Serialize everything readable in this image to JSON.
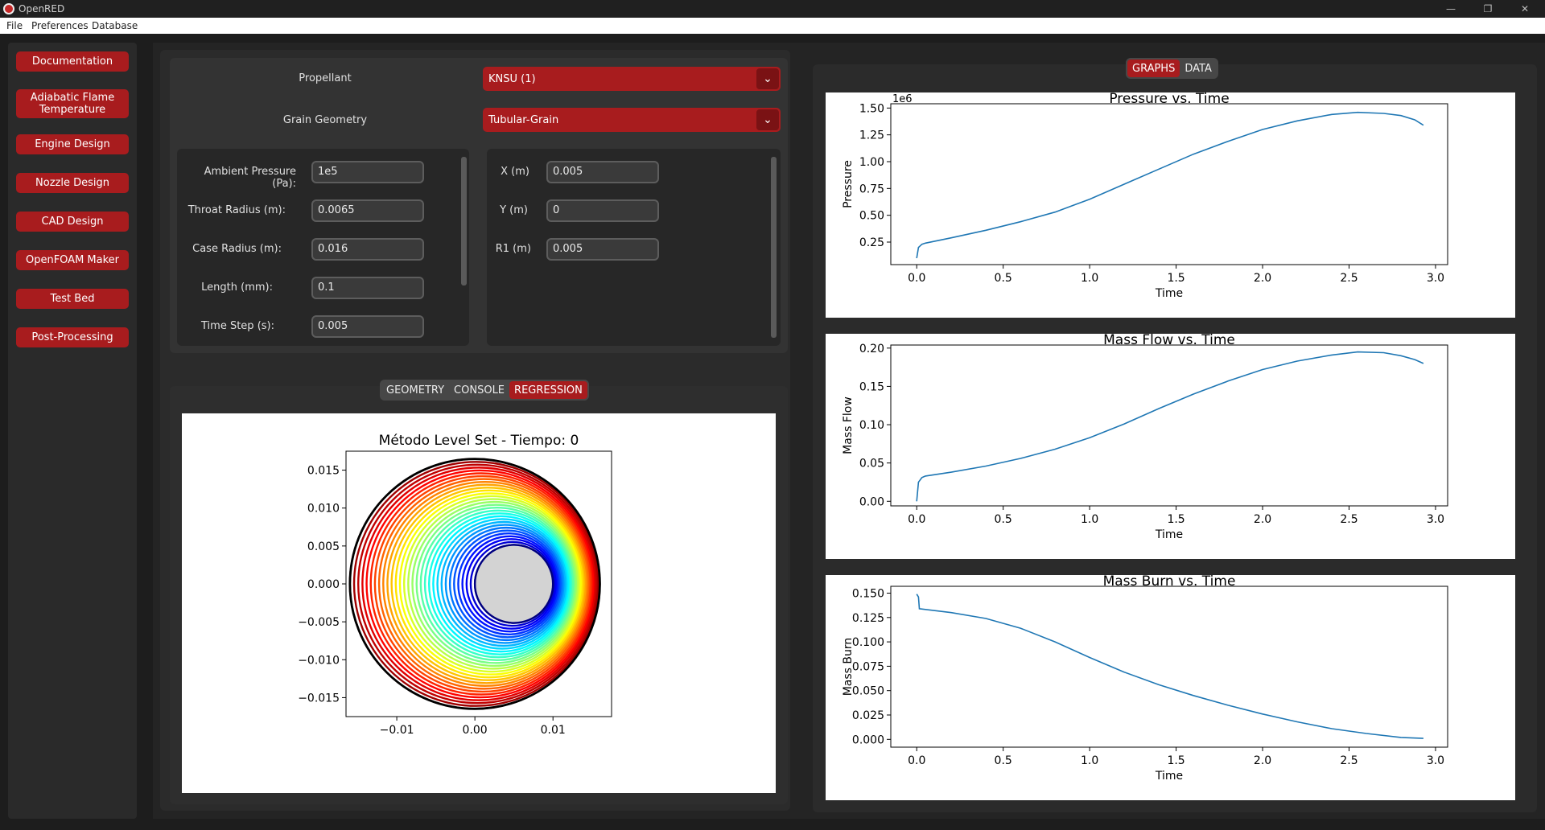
{
  "window": {
    "title": "OpenRED",
    "minimize_glyph": "—",
    "maximize_glyph": "❐",
    "close_glyph": "✕"
  },
  "menu": [
    "File",
    "Preferences",
    "Database"
  ],
  "sidebar": {
    "items": [
      {
        "label": "Documentation"
      },
      {
        "label": "Adiabatic Flame Temperature"
      },
      {
        "label": "Engine Design"
      },
      {
        "label": "Nozzle Design"
      },
      {
        "label": "CAD Design"
      },
      {
        "label": "OpenFOAM Maker"
      },
      {
        "label": "Test Bed"
      },
      {
        "label": "Post-Processing"
      }
    ]
  },
  "config": {
    "propellant": {
      "label": "Propellant",
      "value": "KNSU (1)"
    },
    "grain": {
      "label": "Grain Geometry",
      "value": "Tubular-Grain"
    },
    "chevron": "⌄"
  },
  "params_left": [
    {
      "label": "Ambient Pressure (Pa):",
      "value": "1e5"
    },
    {
      "label": "Throat Radius (m):",
      "value": "0.0065"
    },
    {
      "label": "Case Radius (m):",
      "value": "0.016"
    },
    {
      "label": "Length (mm):",
      "value": "0.1"
    },
    {
      "label": "Time Step (s):",
      "value": "0.005"
    }
  ],
  "params_right": [
    {
      "label": "X  (m)",
      "value": "0.005"
    },
    {
      "label": "Y  (m)",
      "value": "0"
    },
    {
      "label": "R1 (m)",
      "value": "0.005"
    }
  ],
  "bottom_tabs": [
    "GEOMETRY",
    "CONSOLE",
    "REGRESSION"
  ],
  "bottom_active_tab": "REGRESSION",
  "right_tabs": [
    "GRAPHS",
    "DATA"
  ],
  "right_active_tab": "GRAPHS",
  "colors": {
    "accent": "#a81c1e",
    "line": "#1f77b4"
  },
  "chart_data": [
    {
      "type": "contour",
      "title": "Método Level Set - Tiempo: 0",
      "xlim": [
        -0.0165,
        0.0175
      ],
      "ylim": [
        -0.0175,
        0.0175
      ],
      "x_ticks": [
        "−0.01",
        "0.00",
        "0.01"
      ],
      "y_ticks": [
        "0.015",
        "0.010",
        "0.005",
        "0.000",
        "−0.005",
        "−0.010",
        "−0.015"
      ],
      "inner_circle": {
        "cx": 0.005,
        "cy": 0,
        "r": 0.005
      },
      "outer_circle": {
        "cx": 0,
        "cy": 0,
        "r": 0.016
      },
      "colormap": "jet"
    },
    {
      "type": "line",
      "title": "Pressure vs. Time",
      "xlabel": "Time",
      "ylabel": "Pressure",
      "offset_label": "1e6",
      "xlim": [
        -0.15,
        3.07
      ],
      "ylim": [
        0.04,
        1.54
      ],
      "x_ticks": [
        "0.0",
        "0.5",
        "1.0",
        "1.5",
        "2.0",
        "2.5",
        "3.0"
      ],
      "y_ticks": [
        "0.25",
        "0.50",
        "0.75",
        "1.00",
        "1.25",
        "1.50"
      ],
      "x": [
        0.0,
        0.01,
        0.03,
        0.05,
        0.2,
        0.4,
        0.6,
        0.8,
        1.0,
        1.2,
        1.4,
        1.6,
        1.8,
        2.0,
        2.2,
        2.4,
        2.55,
        2.7,
        2.8,
        2.88,
        2.93
      ],
      "values": [
        0.1,
        0.2,
        0.23,
        0.24,
        0.29,
        0.36,
        0.44,
        0.53,
        0.65,
        0.79,
        0.93,
        1.07,
        1.19,
        1.3,
        1.38,
        1.44,
        1.46,
        1.45,
        1.43,
        1.39,
        1.34
      ]
    },
    {
      "type": "line",
      "title": "Mass Flow vs. Time",
      "xlabel": "Time",
      "ylabel": "Mass Flow",
      "xlim": [
        -0.15,
        3.07
      ],
      "ylim": [
        -0.006,
        0.204
      ],
      "x_ticks": [
        "0.0",
        "0.5",
        "1.0",
        "1.5",
        "2.0",
        "2.5",
        "3.0"
      ],
      "y_ticks": [
        "0.20",
        "0.15",
        "0.10",
        "0.05",
        "0.00"
      ],
      "x": [
        0.0,
        0.01,
        0.03,
        0.05,
        0.2,
        0.4,
        0.6,
        0.8,
        1.0,
        1.2,
        1.4,
        1.6,
        1.8,
        2.0,
        2.2,
        2.4,
        2.55,
        2.7,
        2.8,
        2.88,
        2.93
      ],
      "values": [
        0.0,
        0.025,
        0.031,
        0.033,
        0.038,
        0.046,
        0.056,
        0.068,
        0.083,
        0.101,
        0.121,
        0.14,
        0.157,
        0.172,
        0.183,
        0.191,
        0.195,
        0.194,
        0.19,
        0.185,
        0.18
      ]
    },
    {
      "type": "line",
      "title": "Mass Burn vs. Time",
      "xlabel": "Time",
      "ylabel": "Mass Burn",
      "xlim": [
        -0.15,
        3.07
      ],
      "ylim": [
        -0.008,
        0.157
      ],
      "x_ticks": [
        "0.0",
        "0.5",
        "1.0",
        "1.5",
        "2.0",
        "2.5",
        "3.0"
      ],
      "y_ticks": [
        "0.150",
        "0.125",
        "0.100",
        "0.075",
        "0.050",
        "0.025",
        "0.000"
      ],
      "x": [
        0.0,
        0.01,
        0.015,
        0.2,
        0.4,
        0.6,
        0.8,
        1.0,
        1.2,
        1.4,
        1.6,
        1.8,
        2.0,
        2.2,
        2.4,
        2.6,
        2.8,
        2.93
      ],
      "values": [
        0.149,
        0.146,
        0.134,
        0.13,
        0.124,
        0.114,
        0.1,
        0.084,
        0.069,
        0.056,
        0.045,
        0.035,
        0.026,
        0.018,
        0.011,
        0.006,
        0.002,
        0.001
      ]
    }
  ]
}
